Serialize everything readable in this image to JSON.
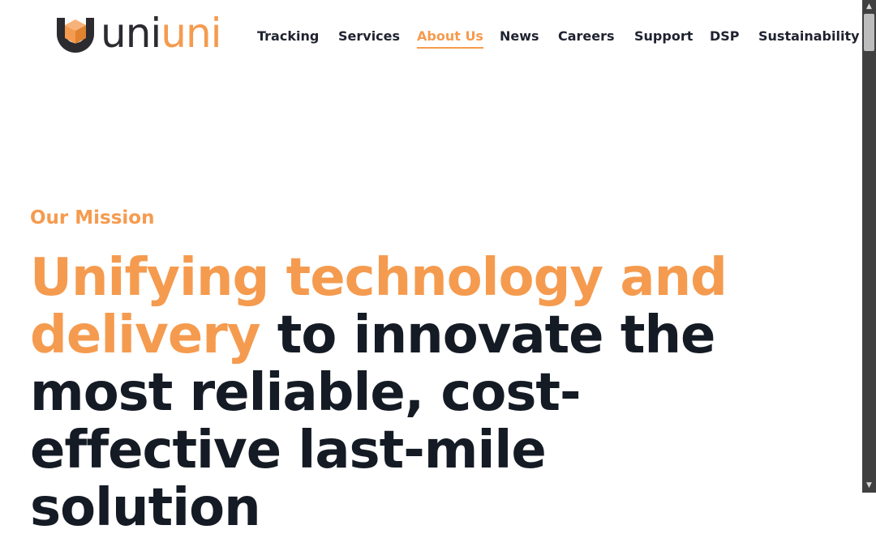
{
  "logo": {
    "part1": "uni",
    "part2": "uni",
    "icon": "cube-shield-icon"
  },
  "nav": {
    "items": [
      {
        "label": "Tracking",
        "active": false
      },
      {
        "label": "Services",
        "active": false
      },
      {
        "label": "About Us",
        "active": true
      },
      {
        "label": "News",
        "active": false
      },
      {
        "label": "Careers",
        "active": false
      },
      {
        "label": "Support",
        "active": false
      },
      {
        "label": "DSP",
        "active": false
      },
      {
        "label": "Sustainability",
        "active": false
      }
    ]
  },
  "hero": {
    "eyebrow": "Our Mission",
    "headline_accent": "Unifying technology and delivery",
    "headline_rest": " to innovate the most reliable, cost-effective last-mile solution"
  },
  "colors": {
    "accent": "#f59b4f",
    "text_dark": "#151b24",
    "scrollbar": "#404040"
  },
  "scrollbar": {
    "up_icon": "scroll-up-arrow-icon",
    "down_icon": "scroll-down-arrow-icon"
  }
}
